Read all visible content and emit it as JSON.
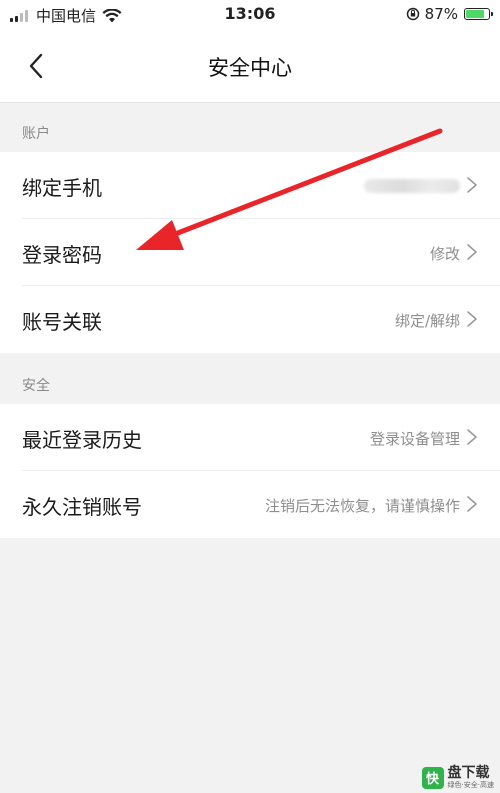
{
  "status_bar": {
    "carrier": "中国电信",
    "time": "13:06",
    "battery_percent": "87%",
    "battery_level": 0.87,
    "icons": [
      "signal-icon",
      "wifi-icon",
      "rotation-lock-icon",
      "battery-icon"
    ]
  },
  "nav": {
    "title": "安全中心",
    "back_icon": "chevron-left-icon"
  },
  "sections": {
    "account": {
      "header": "账户",
      "rows": [
        {
          "label": "绑定手机",
          "value": "",
          "value_blurred": true
        },
        {
          "label": "登录密码",
          "value": "修改"
        },
        {
          "label": "账号关联",
          "value": "绑定/解绑"
        }
      ]
    },
    "security": {
      "header": "安全",
      "rows": [
        {
          "label": "最近登录历史",
          "value": "登录设备管理"
        },
        {
          "label": "永久注销账号",
          "value": "注销后无法恢复，请谨慎操作"
        }
      ]
    }
  },
  "annotation": {
    "type": "red-arrow",
    "color": "#e8262a"
  },
  "watermark": {
    "logo_char": "快",
    "text": "盘下载",
    "sub": "绿色·安全·高速"
  },
  "colors": {
    "background": "#f2f2f2",
    "row_background": "#ffffff",
    "secondary_text": "#8e8e8e",
    "battery_green": "#4cd964"
  }
}
